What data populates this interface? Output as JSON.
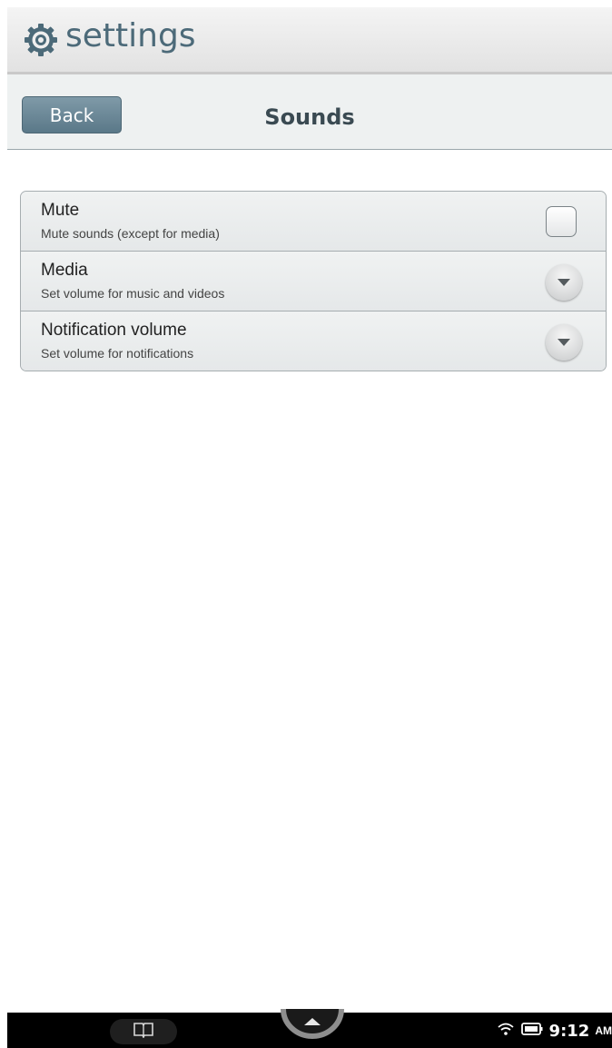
{
  "header": {
    "app_title": "settings",
    "icon": "gear-icon"
  },
  "subbar": {
    "back_label": "Back",
    "page_title": "Sounds"
  },
  "settings": [
    {
      "label": "Mute",
      "description": "Mute sounds (except for media)",
      "control": "checkbox",
      "checked": false
    },
    {
      "label": "Media",
      "description": "Set volume for music and videos",
      "control": "dropdown-arrow-icon"
    },
    {
      "label": "Notification volume",
      "description": "Set volume for notifications",
      "control": "dropdown-arrow-icon"
    }
  ],
  "navbar": {
    "book_icon": "library-icon",
    "up_icon": "up-arrow-icon",
    "wifi_icon": "wifi-icon",
    "battery_icon": "battery-icon",
    "time": "9:12",
    "ampm": "AM"
  },
  "colors": {
    "header_text": "#4c6a79",
    "back_button": "#6a8898",
    "nav_background": "#000000"
  }
}
